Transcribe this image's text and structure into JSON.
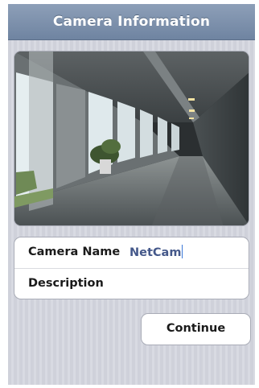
{
  "header": {
    "title": "Camera Information"
  },
  "camera_preview": {
    "description_icon": "camera-feed-image"
  },
  "form": {
    "camera_name": {
      "label": "Camera Name",
      "value": "NetCam"
    },
    "description": {
      "label": "Description",
      "value": ""
    }
  },
  "actions": {
    "continue_label": "Continue"
  },
  "colors": {
    "title_bar": "#7d90ab",
    "field_text": "#44588a",
    "background_stripe": "#d1d3dc"
  }
}
